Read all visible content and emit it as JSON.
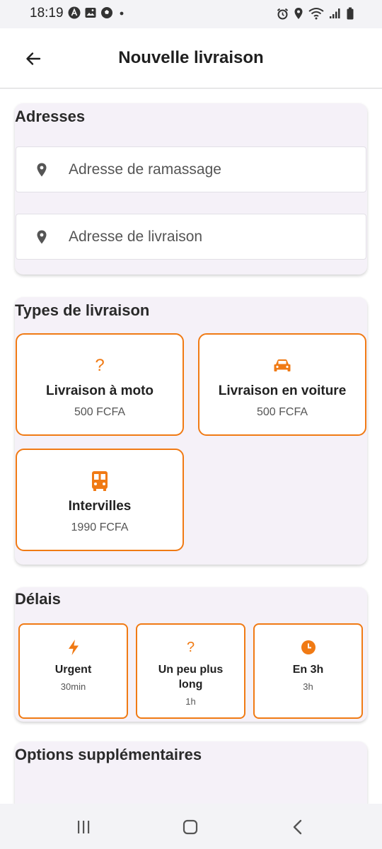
{
  "status_bar": {
    "time": "18:19",
    "left_icons": [
      "app-a-icon",
      "gallery-icon",
      "soccer-icon",
      "dot-icon"
    ],
    "right_icons": [
      "alarm-icon",
      "location-icon",
      "wifi-icon",
      "signal-icon",
      "battery-icon"
    ]
  },
  "app_bar": {
    "title": "Nouvelle livraison",
    "back_icon": "arrow-back-icon"
  },
  "addresses": {
    "title": "Adresses",
    "pickup_placeholder": "Adresse de ramassage",
    "delivery_placeholder": "Adresse de livraison"
  },
  "delivery_types": {
    "title": "Types de livraison",
    "accent_color": "#f07a14",
    "items": [
      {
        "name": "Livraison à moto",
        "price": "500 FCFA",
        "icon": "question-icon"
      },
      {
        "name": "Livraison en voiture",
        "price": "500 FCFA",
        "icon": "car-icon"
      },
      {
        "name": "Intervilles",
        "price": "1990 FCFA",
        "icon": "bus-icon"
      }
    ]
  },
  "delays": {
    "title": "Délais",
    "items": [
      {
        "name": "Urgent",
        "time": "30min",
        "icon": "bolt-icon"
      },
      {
        "name": "Un peu plus long",
        "time": "1h",
        "icon": "question-icon"
      },
      {
        "name": "En 3h",
        "time": "3h",
        "icon": "clock-icon"
      }
    ]
  },
  "options": {
    "title": "Options supplémentaires"
  },
  "nav_bar": {
    "icons": [
      "recent-apps-icon",
      "home-icon",
      "back-nav-icon"
    ]
  }
}
